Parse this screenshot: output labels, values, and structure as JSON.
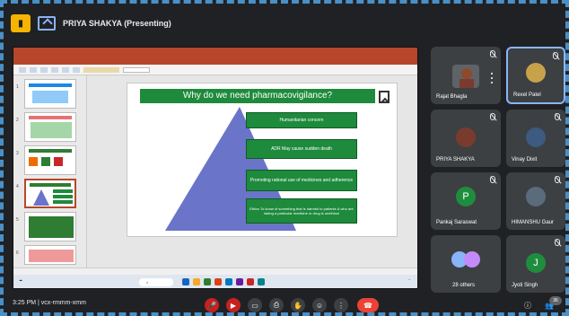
{
  "topbar": {
    "presenter_label": "PRIYA SHAKYA (Presenting)"
  },
  "slide": {
    "title": "Why do we need pharmacovigilance?",
    "boxes": [
      "Humanitarian concern",
      "ADR May cause sudden death",
      "Promoting rational use of medicines and adherence",
      "Ethics To know of something that is harmful to patients & who are taking a particular medicine or drug is unethical"
    ]
  },
  "participants": [
    {
      "name": "Rajat Bhagla",
      "initial": "",
      "avatar_color": "#8d4a2b"
    },
    {
      "name": "Rexel Patel",
      "initial": "",
      "avatar_color": "#c8a24a"
    },
    {
      "name": "PRIYA SHAKYA",
      "initial": "",
      "avatar_color": "#7a3b2e"
    },
    {
      "name": "Vinay Dixit",
      "initial": "",
      "avatar_color": "#3d5a80"
    },
    {
      "name": "Pankaj Saraswat",
      "initial": "P",
      "avatar_color": "#1e8e3e"
    },
    {
      "name": "HIMANSHU Gaur",
      "initial": "",
      "avatar_color": "#5a6b7c"
    },
    {
      "name": "28 others",
      "initial": "",
      "avatar_color": "#8ab4f8"
    },
    {
      "name": "Jyoti Singh",
      "initial": "J",
      "avatar_color": "#1e8e3e"
    }
  ],
  "bottombar": {
    "time": "3:25 PM",
    "meeting_code": "vcx-rmmm-xmm",
    "participant_count": "36"
  },
  "colors": {
    "accent": "#8ab4f8",
    "slide_green": "#1e8a3c",
    "pyramid": "#6a74c9",
    "end_call": "#ea4335"
  }
}
